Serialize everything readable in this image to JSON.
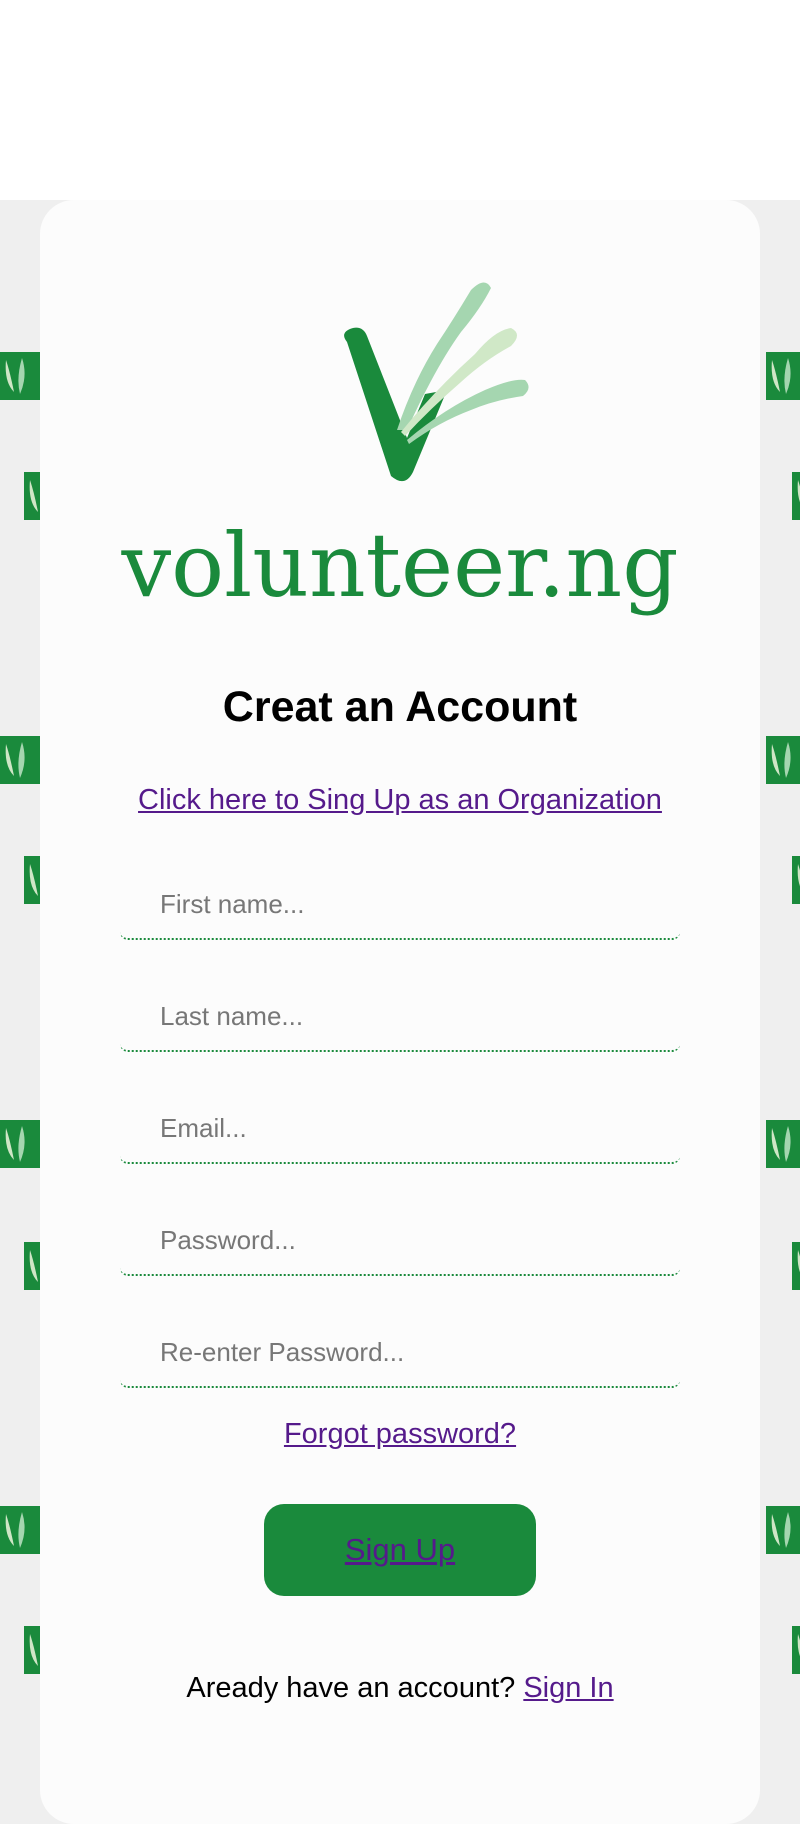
{
  "brand": {
    "logo_icon": "v-leaf-logo-icon",
    "name": "volunteer.ng",
    "primary_color": "#1a8a3c",
    "leaf_colors": [
      "#a5d6b0",
      "#d0e8c7"
    ]
  },
  "background": {
    "pattern_icon": "leaf-pattern-icon",
    "color": "#efefef"
  },
  "form": {
    "title": "Creat an Account",
    "org_link": "Click here to Sing Up as an Organization",
    "fields": {
      "first_name": {
        "placeholder": "First name...",
        "value": ""
      },
      "last_name": {
        "placeholder": "Last name...",
        "value": ""
      },
      "email": {
        "placeholder": "Email...",
        "value": ""
      },
      "password": {
        "placeholder": "Password...",
        "value": ""
      },
      "confirm_password": {
        "placeholder": "Re-enter Password...",
        "value": ""
      }
    },
    "forgot_link": "Forgot password?",
    "submit_label": "Sign Up",
    "signin_prompt": "Aready have an account?",
    "signin_link": "Sign In"
  }
}
